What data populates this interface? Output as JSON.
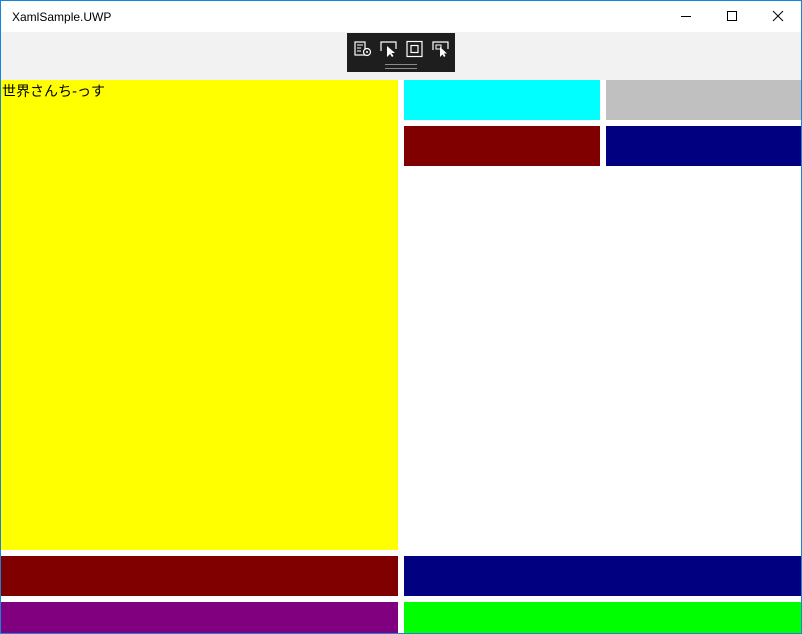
{
  "window": {
    "title": "XamlSample.UWP"
  },
  "caption_buttons": {
    "minimize": "minimize-icon",
    "maximize": "maximize-icon",
    "close": "close-icon"
  },
  "debug_toolbar": {
    "tools": [
      "live-visual-tree-icon",
      "select-element-icon",
      "display-layout-adorners-icon",
      "track-focus-icon"
    ]
  },
  "content": {
    "greeting": "世界さんち-っす",
    "colors": {
      "yellow": "#ffff00",
      "cyan": "#00ffff",
      "silver": "#c0c0c0",
      "maroon": "#800000",
      "navy": "#000080",
      "purple": "#800080",
      "lime": "#00ff00",
      "accent_border": "#1883d7"
    }
  }
}
